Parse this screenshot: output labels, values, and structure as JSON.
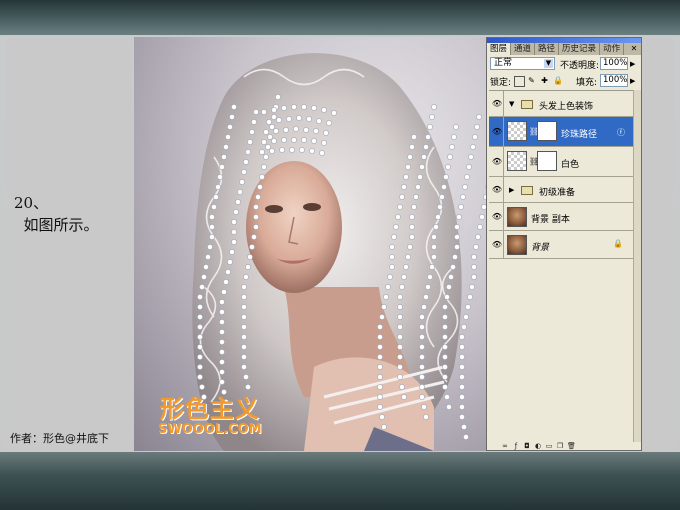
{
  "tutorial": {
    "step_label": "20、\n  如图所示。",
    "author": "作者：形色@井底下",
    "watermark_logo": "形色主义",
    "watermark_url": "SWOOOL.COM"
  },
  "palette": {
    "tabs": [
      "图层",
      "通道",
      "路径",
      "历史记录",
      "动作"
    ],
    "blend_mode": "正常",
    "opacity_label": "不透明度:",
    "opacity_value": "100%",
    "lock_label": "锁定:",
    "fill_label": "填充:",
    "fill_value": "100%",
    "layers": [
      {
        "name": "头发上色装饰",
        "kind": "group",
        "expanded": true
      },
      {
        "name": "珍珠路径",
        "kind": "layer",
        "selected": true
      },
      {
        "name": "白色",
        "kind": "layer"
      },
      {
        "name": "初级准备",
        "kind": "group",
        "expanded": false
      },
      {
        "name": "背景 副本",
        "kind": "layer"
      },
      {
        "name": "背景",
        "kind": "layer",
        "locked": true
      }
    ],
    "bottom_icons": [
      "link-icon",
      "fx-icon",
      "mask-icon",
      "adjustment-icon",
      "folder-icon",
      "new-layer-icon",
      "trash-icon"
    ]
  },
  "colors": {
    "selected_row": "#316ac5",
    "watermark": "#f29a2e",
    "panel_bg": "#ece9d8"
  }
}
